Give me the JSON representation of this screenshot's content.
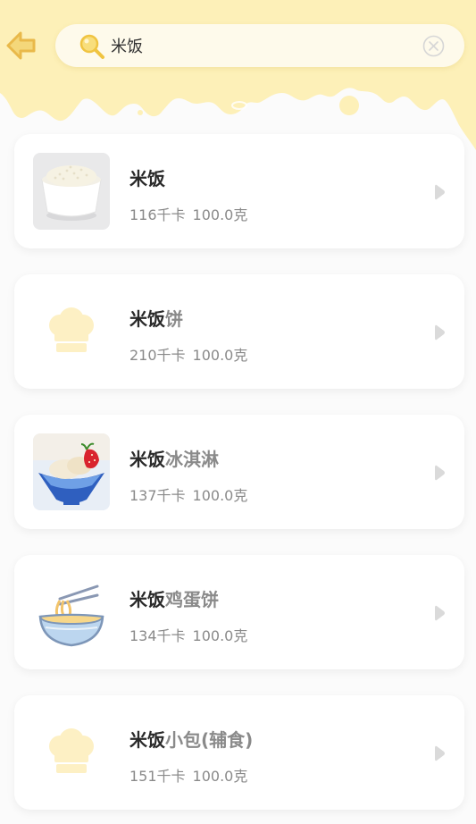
{
  "search": {
    "value": "米饭"
  },
  "results": [
    {
      "highlight": "米饭",
      "rest": "",
      "kcal": "116千卡",
      "weight": "100.0克",
      "image_icon": "rice-bowl-photo"
    },
    {
      "highlight": "米饭",
      "rest": "饼",
      "kcal": "210千卡",
      "weight": "100.0克",
      "image_icon": "chef-hat-placeholder-icon"
    },
    {
      "highlight": "米饭",
      "rest": "冰淇淋",
      "kcal": "137千卡",
      "weight": "100.0克",
      "image_icon": "ice-cream-photo"
    },
    {
      "highlight": "米饭",
      "rest": "鸡蛋饼",
      "kcal": "134千卡",
      "weight": "100.0克",
      "image_icon": "noodle-bowl-icon"
    },
    {
      "highlight": "米饭",
      "rest": "小包(辅食)",
      "kcal": "151千卡",
      "weight": "100.0克",
      "image_icon": "chef-hat-placeholder-icon"
    }
  ],
  "colors": {
    "cream": "#fdf0b8",
    "accent": "#f2d26b",
    "highlight_text": "#2a2a2a",
    "muted_text": "#8a8a8a"
  }
}
